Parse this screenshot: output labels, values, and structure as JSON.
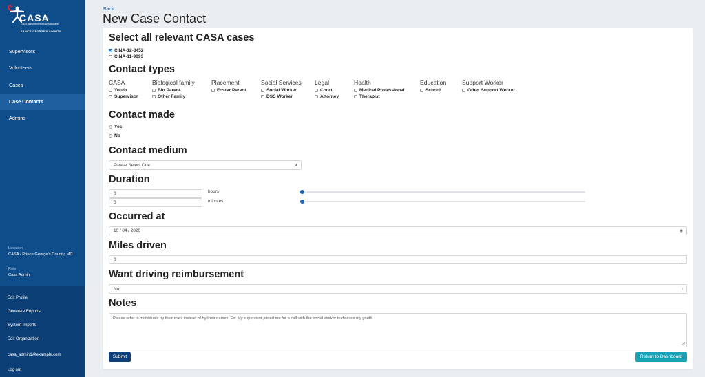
{
  "sidebar": {
    "logo": {
      "brand": "CASA",
      "tagline": "Court Appointed Special Advocates",
      "county": "PRINCE GEORGE'S COUNTY"
    },
    "nav": [
      {
        "label": "Supervisors"
      },
      {
        "label": "Volunteers"
      },
      {
        "label": "Cases"
      },
      {
        "label": "Case Contacts"
      },
      {
        "label": "Admins"
      }
    ],
    "location_label": "Location",
    "location_value": "CASA / Prince George's County, MD",
    "role_label": "Role",
    "role_value": "Casa Admin",
    "bottom": [
      {
        "label": "Edit Profile"
      },
      {
        "label": "Generate Reports"
      },
      {
        "label": "System Imports"
      },
      {
        "label": "Edit Organization"
      },
      {
        "label": "casa_admin1@example.com"
      },
      {
        "label": "Log out"
      }
    ],
    "colors": {
      "background": "#0f4c8a",
      "active": "#1d5f9f",
      "bottom": "#0c3f75"
    }
  },
  "header": {
    "back": "Back",
    "title": "New Case Contact"
  },
  "form": {
    "cases": {
      "heading": "Select all relevant CASA cases",
      "items": [
        {
          "label": "CINA-12-3452",
          "checked": true
        },
        {
          "label": "CINA-11-9093",
          "checked": false
        }
      ]
    },
    "contact_types": {
      "heading": "Contact types",
      "groups": [
        {
          "title": "CASA",
          "items": [
            "Youth",
            "Supervisor"
          ]
        },
        {
          "title": "Biological family",
          "items": [
            "Bio Parent",
            "Other Family"
          ]
        },
        {
          "title": "Placement",
          "items": [
            "Foster Parent"
          ]
        },
        {
          "title": "Social Services",
          "items": [
            "Social Worker",
            "DSS Worker"
          ]
        },
        {
          "title": "Legal",
          "items": [
            "Court",
            "Attorney"
          ]
        },
        {
          "title": "Health",
          "items": [
            "Medical Professional",
            "Therapist"
          ]
        },
        {
          "title": "Education",
          "items": [
            "School"
          ]
        },
        {
          "title": "Support Worker",
          "items": [
            "Other Support Worker"
          ]
        }
      ]
    },
    "contact_made": {
      "heading": "Contact made",
      "options": [
        "Yes",
        "No"
      ]
    },
    "contact_medium": {
      "heading": "Contact medium",
      "selected": "Please Select One"
    },
    "duration": {
      "heading": "Duration",
      "hours_value": "0",
      "hours_unit": "hours",
      "minutes_value": "0",
      "minutes_unit": "minutes"
    },
    "occurred_at": {
      "heading": "Occurred at",
      "value": "10 / 04 / 2020"
    },
    "miles_driven": {
      "heading": "Miles driven",
      "value": "0"
    },
    "reimbursement": {
      "heading": "Want driving reimbursement",
      "selected": "No"
    },
    "notes": {
      "heading": "Notes",
      "placeholder": "Please refer to individuals by their roles instead of by their names. Ex: My supervisor joined me for a call with the social worker to discuss my youth."
    },
    "submit": "Submit",
    "return": "Return to Dashboard"
  },
  "colors": {
    "primary": "#0f3f7a",
    "accent": "#17a2b8",
    "link": "#1b6ec2"
  }
}
